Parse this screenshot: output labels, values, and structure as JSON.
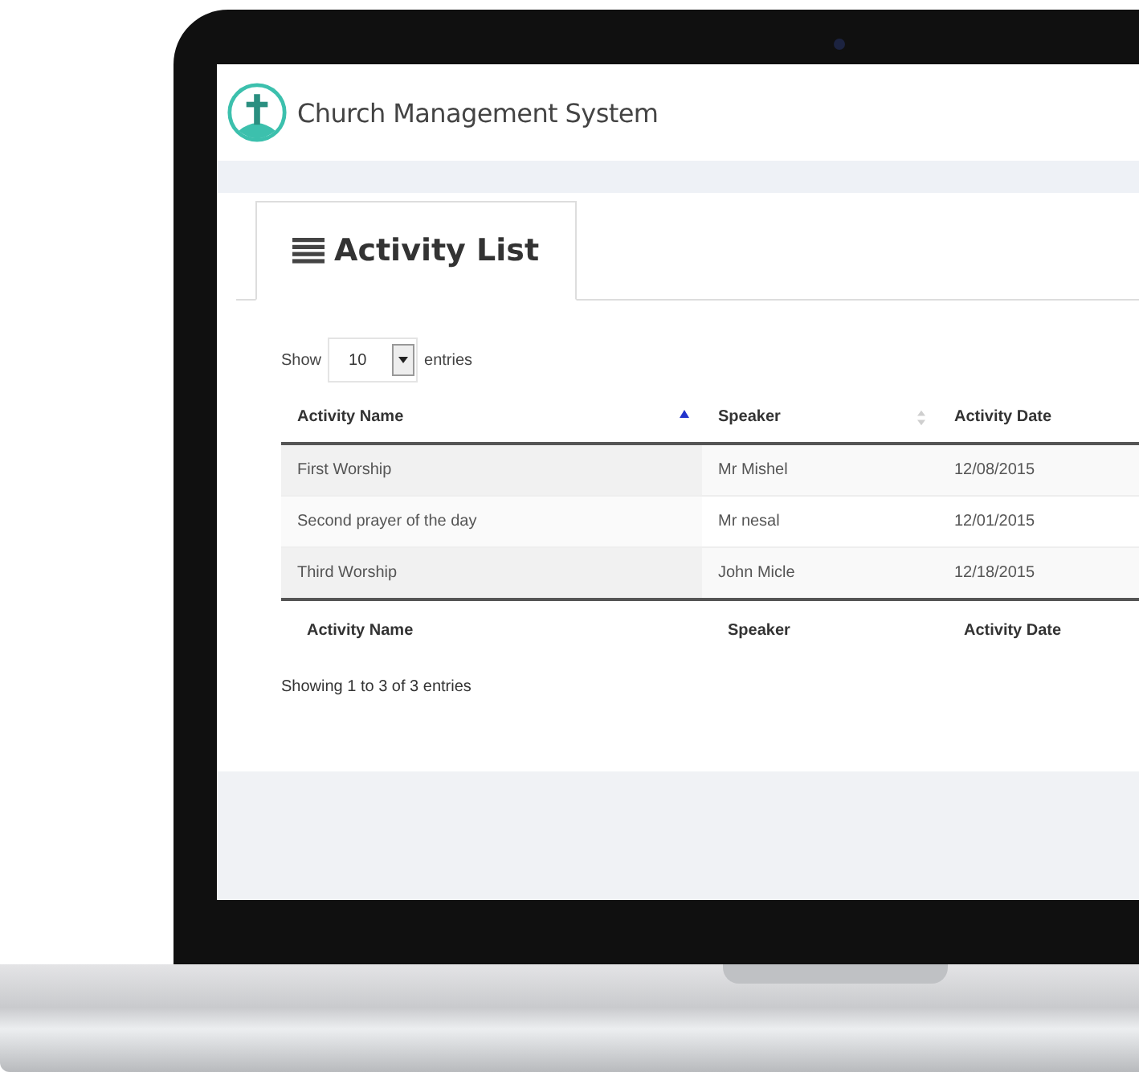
{
  "app": {
    "title": "Church Management System"
  },
  "tab": {
    "label": "Activity List",
    "selected": true
  },
  "length_control": {
    "prefix": "Show",
    "value": "10",
    "suffix": "entries"
  },
  "table": {
    "columns": [
      {
        "label": "Activity Name",
        "sorted": true
      },
      {
        "label": "Speaker",
        "sorted": false
      },
      {
        "label": "Activity Date"
      }
    ],
    "rows": [
      {
        "cells": [
          "First Worship",
          "Mr Mishel",
          "12/08/2015"
        ]
      },
      {
        "cells": [
          "Second prayer of the day",
          "Mr nesal",
          "12/01/2015"
        ]
      },
      {
        "cells": [
          "Third Worship",
          "John Micle",
          "12/18/2015"
        ]
      }
    ],
    "footer_columns": [
      "Activity Name",
      "Speaker",
      "Activity Date"
    ]
  },
  "info": "Showing 1 to 3 of 3 entries"
}
